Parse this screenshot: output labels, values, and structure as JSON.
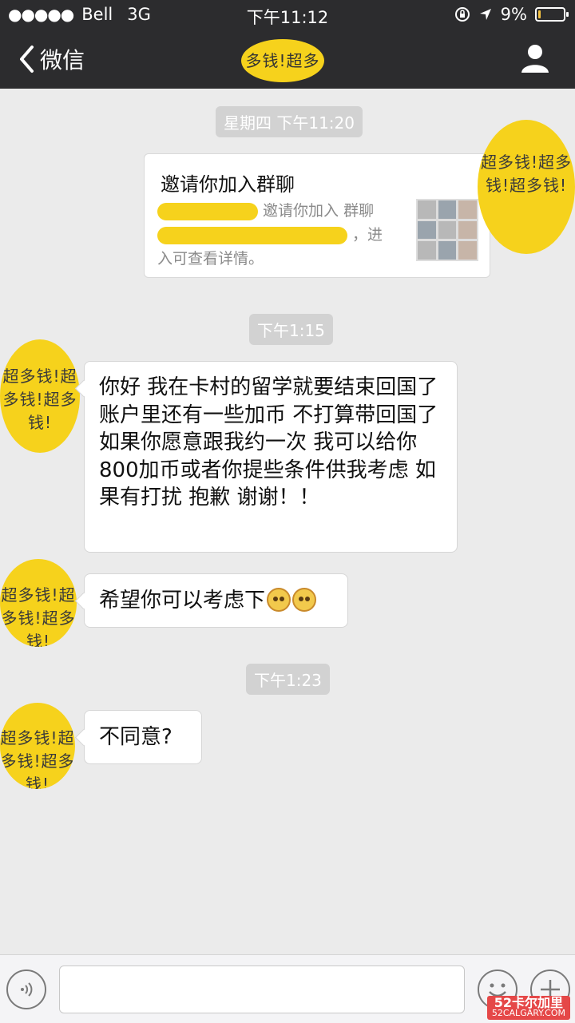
{
  "status_bar": {
    "signal_dots": "●●●●●",
    "carrier": "Bell",
    "network": "3G",
    "time": "下午11:12",
    "battery_text": "9%",
    "battery_level": 0.09
  },
  "nav": {
    "back_label": "微信",
    "title": "多钱!超多"
  },
  "timestamps": {
    "t1": "星期四 下午11:20",
    "t2": "下午1:15",
    "t3": "下午1:23"
  },
  "invite_card": {
    "title": "邀请你加入群聊",
    "desc_line1": "邀请你加入 群聊",
    "desc_line2": "，进",
    "desc_line3": "入可查看详情。"
  },
  "avatar_text": "超多钱!超多钱!超多钱!",
  "messages": [
    {
      "text": "你好 我在卡村的留学就要结束回国了 账户里还有一些加币 不打算带回国了 如果你愿意跟我约一次 我可以给你800加币或者你提些条件供我考虑 如果有打扰 抱歉 谢谢！！"
    },
    {
      "text": "希望你可以考虑下"
    },
    {
      "text": "不同意?"
    }
  ],
  "input": {
    "placeholder": ""
  },
  "watermark": {
    "brand": "52卡尔加里",
    "url": "52CALGARY.COM"
  },
  "colors": {
    "header": "#2c2c2e",
    "background": "#ebebeb",
    "redaction": "#f6d21c"
  }
}
